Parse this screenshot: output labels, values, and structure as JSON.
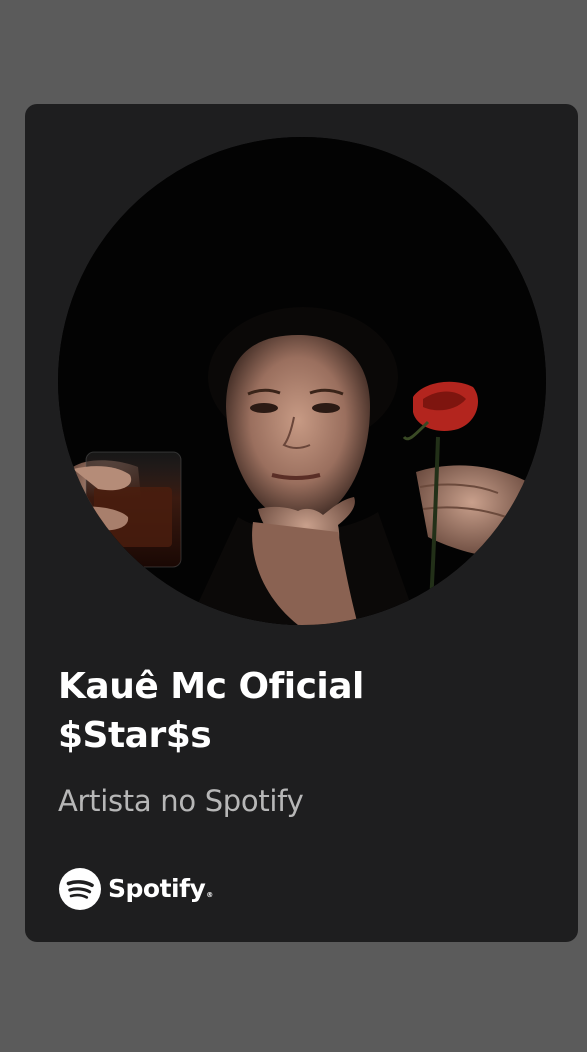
{
  "card": {
    "title_line1": "Kauê Mc Oficial",
    "title_line2": "$Star$s",
    "subtitle": "Artista no Spotify"
  },
  "photo": {
    "description_icon": "artist-photo"
  },
  "brand": {
    "name": "Spotify",
    "registered": "®",
    "icon": "spotify-logo-icon"
  },
  "colors": {
    "background": "#5b5b5b",
    "card": "#1e1e1f",
    "title": "#ffffff",
    "subtitle": "#b7b7b7",
    "rose": "#b3251e"
  }
}
